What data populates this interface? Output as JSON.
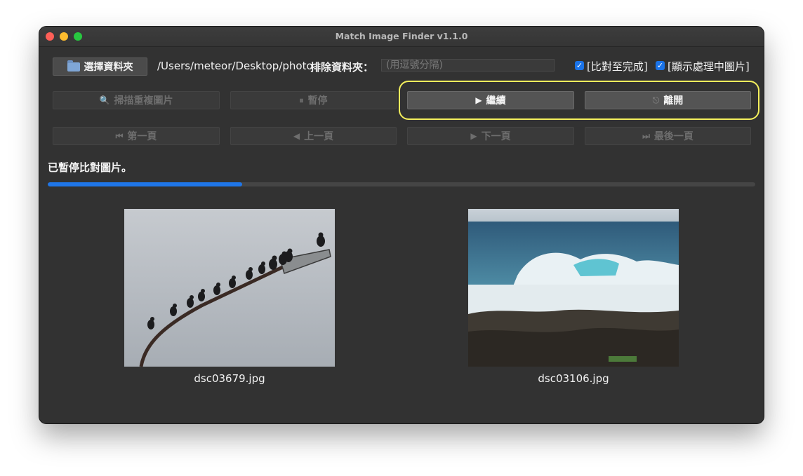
{
  "window": {
    "title": "Match Image Finder v1.1.0"
  },
  "toolbar": {
    "choose_folder_label": "選擇資料夾",
    "folder_path": "/Users/meteor/Desktop/photo",
    "exclude_label": "排除資料夾：",
    "exclude_placeholder": "(用逗號分隔)",
    "compare_complete_label": "[比對至完成]",
    "compare_complete_checked": true,
    "show_processing_label": "[顯示處理中圖片]",
    "show_processing_checked": true
  },
  "actions": {
    "scan_label": "掃描重複圖片",
    "pause_label": "暫停",
    "continue_label": "繼續",
    "exit_label": "離開"
  },
  "pagination": {
    "first_label": "第一頁",
    "prev_label": "上一頁",
    "next_label": "下一頁",
    "last_label": "最後一頁"
  },
  "status": {
    "message": "已暫停比對圖片。",
    "progress": 0.275
  },
  "images": [
    {
      "filename": "dsc03679.jpg"
    },
    {
      "filename": "dsc03106.jpg"
    }
  ],
  "colors": {
    "accent": "#1f76e8",
    "highlight": "#f4ef5c",
    "window_bg": "#323232"
  }
}
